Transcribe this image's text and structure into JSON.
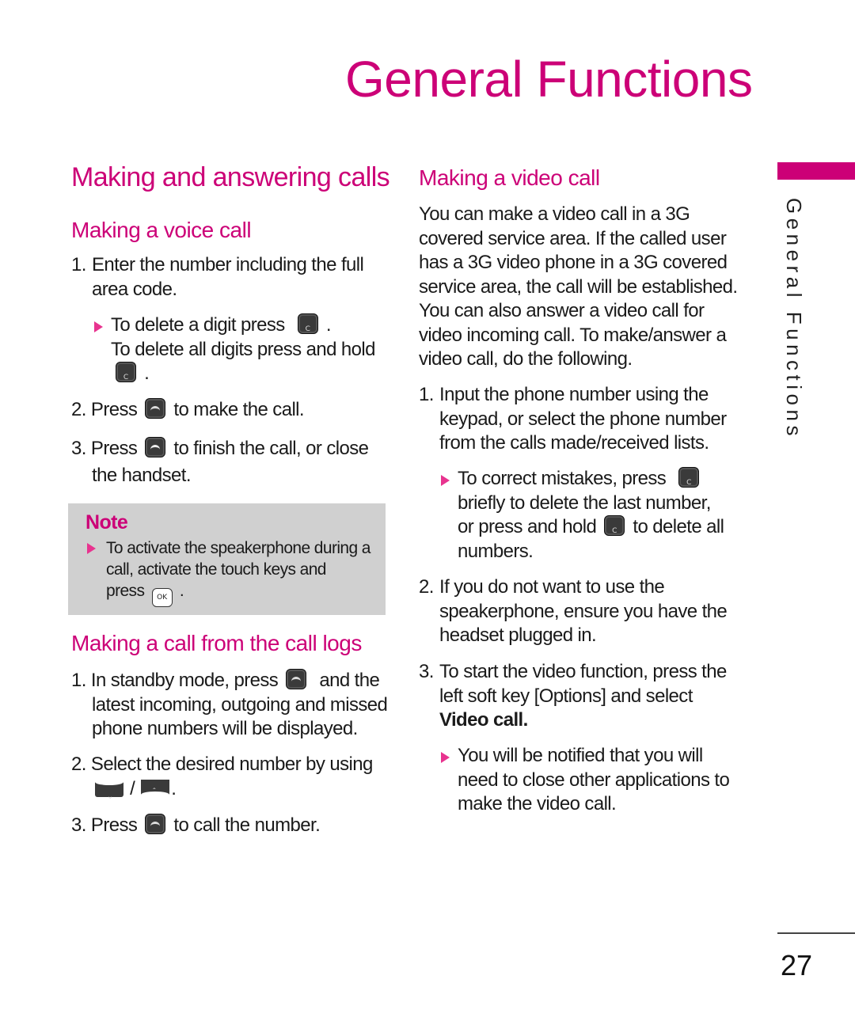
{
  "page_title": "General Functions",
  "side_tab": {
    "label": "General Functions",
    "accent_color": "#cc0077"
  },
  "page_number": "27",
  "left_column": {
    "section_title": "Making and answering calls",
    "voice_call": {
      "title": "Making a voice call",
      "steps": [
        {
          "num": "1.",
          "line1": "Enter the number including the full",
          "line2": "area code."
        },
        {
          "num": "2.",
          "before": "Press",
          "after": "to make the call.",
          "icon": "send-key-icon"
        },
        {
          "num": "3.",
          "before": "Press",
          "after": "to finish the call, or close",
          "line2": "the handset.",
          "icon": "end-key-icon"
        }
      ],
      "bullet": {
        "part1": "To delete a digit press",
        "part1_end": ".",
        "part2": "To delete all digits press and hold",
        "part2_end": ".",
        "key_label": "C"
      }
    },
    "note": {
      "title": "Note",
      "line1": "To activate the speakerphone during a",
      "line2": "call, activate the touch keys and",
      "line3": "press",
      "line3_end": ".",
      "ok_label": "OK"
    },
    "call_logs": {
      "title": "Making a call from the call logs",
      "steps": [
        {
          "num": "1.",
          "before": "In standby mode, press",
          "after": "and the",
          "line2": "latest incoming, outgoing and missed",
          "line3": "phone numbers will be displayed."
        },
        {
          "num": "2.",
          "line1": "Select the desired number by using",
          "separator": "/",
          "end": "."
        },
        {
          "num": "3.",
          "before": "Press",
          "after": "to call the number."
        }
      ]
    }
  },
  "right_column": {
    "video_call": {
      "title": "Making a video call",
      "intro": [
        "You can make a video call in a 3G",
        "covered service area. If the called user",
        "has a 3G video phone in a 3G covered",
        "service area, the call will be established.",
        "You can also answer a video call for",
        "video incoming call. To make/answer a",
        "video call, do the following."
      ],
      "steps": [
        {
          "num": "1.",
          "lines": [
            "Input the phone number using the",
            "keypad, or select the phone number",
            "from the calls made/received lists."
          ]
        },
        {
          "num": "2.",
          "lines": [
            "If you do not want to use the",
            "speakerphone, ensure you have the",
            "headset plugged in."
          ]
        },
        {
          "num": "3.",
          "lines": [
            "To start the video function, press the",
            "left soft key [Options] and select"
          ],
          "bold_line": "Video call."
        }
      ],
      "bullet1": {
        "line1": "To correct mistakes, press",
        "line2": "briefly to delete the last number,",
        "line3_before": "or press and hold",
        "line3_after": "to delete all",
        "line4": "numbers.",
        "key_label": "C"
      },
      "bullet2": {
        "lines": [
          "You will be notified that you will",
          "need to close other applications to",
          "make the video call."
        ]
      }
    }
  }
}
